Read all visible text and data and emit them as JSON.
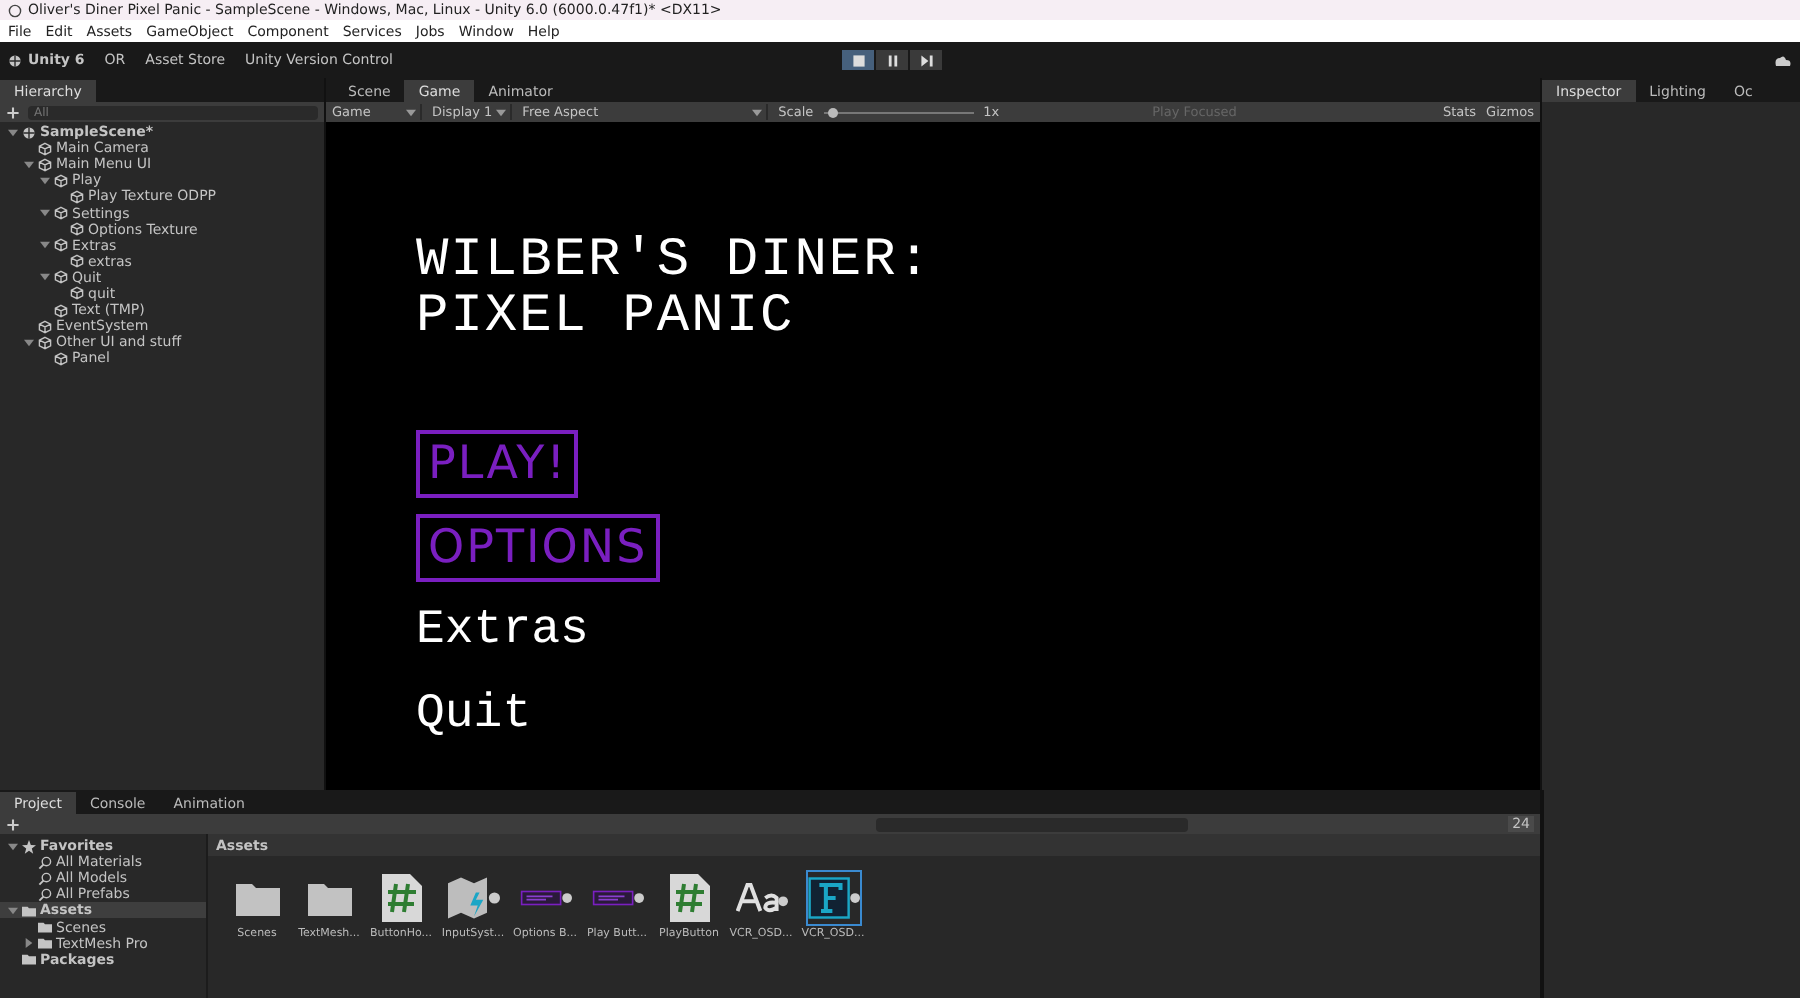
{
  "window": {
    "title": "Oliver's Diner Pixel Panic - SampleScene - Windows, Mac, Linux - Unity 6.0 (6000.0.47f1)* <DX11>"
  },
  "menu": [
    "File",
    "Edit",
    "Assets",
    "GameObject",
    "Component",
    "Services",
    "Jobs",
    "Window",
    "Help"
  ],
  "toolbar": {
    "account": "Unity 6",
    "user": "OR",
    "asset_store": "Asset Store",
    "version_control": "Unity Version Control",
    "play_controls": [
      {
        "kind": "stop",
        "selected": true
      },
      {
        "kind": "pause",
        "selected": false
      },
      {
        "kind": "step",
        "selected": false
      }
    ]
  },
  "hierarchy": {
    "tab": "Hierarchy",
    "search_placeholder": "All",
    "tree": [
      {
        "label": "SampleScene*",
        "kind": "scene",
        "expanded": true,
        "children": [
          {
            "label": "Main Camera",
            "kind": "object"
          },
          {
            "label": "Main Menu UI",
            "kind": "object",
            "expanded": true,
            "children": [
              {
                "label": "Play",
                "kind": "object",
                "expanded": true,
                "children": [
                  {
                    "label": "Play Texture ODPP",
                    "kind": "object"
                  }
                ]
              },
              {
                "label": "Settings",
                "kind": "object",
                "expanded": true,
                "children": [
                  {
                    "label": "Options Texture",
                    "kind": "object"
                  }
                ]
              },
              {
                "label": "Extras",
                "kind": "object",
                "expanded": true,
                "children": [
                  {
                    "label": "extras",
                    "kind": "object"
                  }
                ]
              },
              {
                "label": "Quit",
                "kind": "object",
                "expanded": true,
                "children": [
                  {
                    "label": "quit",
                    "kind": "object"
                  }
                ]
              },
              {
                "label": "Text (TMP)",
                "kind": "object"
              }
            ]
          },
          {
            "label": "EventSystem",
            "kind": "object"
          },
          {
            "label": "Other UI and stuff",
            "kind": "object",
            "expanded": true,
            "children": [
              {
                "label": "Panel",
                "kind": "object"
              }
            ]
          }
        ]
      }
    ]
  },
  "center_tabs": [
    {
      "label": "Scene",
      "selected": false
    },
    {
      "label": "Game",
      "selected": true
    },
    {
      "label": "Animator",
      "selected": false
    }
  ],
  "game_toolbar": {
    "mode": "Game",
    "display": "Display 1",
    "aspect": "Free Aspect",
    "scale_label": "Scale",
    "scale": {
      "level": 0.03
    },
    "scale_value": "1x",
    "play_mode": "Play Focused",
    "stats": "Stats",
    "gizmos": "Gizmos"
  },
  "game_view": {
    "title_lines": [
      "WILBER'S DINER:",
      "PIXEL PANIC"
    ],
    "buttons": [
      {
        "label": "PLAY!",
        "kind": "sketch"
      },
      {
        "label": "OPTIONS",
        "kind": "sketch"
      },
      {
        "label": "Extras",
        "kind": "plain"
      },
      {
        "label": "Quit",
        "kind": "plain"
      }
    ]
  },
  "right_tabs": [
    {
      "label": "Inspector",
      "selected": true
    },
    {
      "label": "Lighting",
      "selected": false
    },
    {
      "label": "Oc",
      "selected": false
    }
  ],
  "bottom_tabs": [
    {
      "label": "Project",
      "selected": true
    },
    {
      "label": "Console",
      "selected": false
    },
    {
      "label": "Animation",
      "selected": false
    }
  ],
  "project": {
    "hidden_count": "24",
    "tree": [
      {
        "label": "Favorites",
        "kind": "favorites",
        "expanded": true,
        "selected": false,
        "children": [
          {
            "label": "All Materials",
            "kind": "search",
            "selected": false
          },
          {
            "label": "All Models",
            "kind": "search",
            "selected": false
          },
          {
            "label": "All Prefabs",
            "kind": "search",
            "selected": false
          }
        ]
      },
      {
        "label": "Assets",
        "kind": "folder",
        "expanded": true,
        "selected": true,
        "children": [
          {
            "label": "Scenes",
            "kind": "folder",
            "selected": false
          },
          {
            "label": "TextMesh Pro",
            "kind": "folder",
            "expanded": false,
            "selected": false
          }
        ]
      },
      {
        "label": "Packages",
        "kind": "folder",
        "selected": false
      }
    ],
    "breadcrumb": "Assets",
    "assets": [
      {
        "label": "Scenes",
        "kind": "folder",
        "selected": false
      },
      {
        "label": "TextMesh...",
        "kind": "folder",
        "selected": false
      },
      {
        "label": "ButtonHo...",
        "kind": "script",
        "selected": false
      },
      {
        "label": "InputSyst...",
        "kind": "input",
        "selected": false
      },
      {
        "label": "Options B...",
        "kind": "sprite",
        "selected": false
      },
      {
        "label": "Play Butt...",
        "kind": "sprite",
        "selected": false
      },
      {
        "label": "PlayButton",
        "kind": "script",
        "selected": false
      },
      {
        "label": "VCR_OSD...",
        "kind": "font",
        "selected": false
      },
      {
        "label": "VCR_OSD...",
        "kind": "fontasset",
        "selected": true
      }
    ]
  }
}
